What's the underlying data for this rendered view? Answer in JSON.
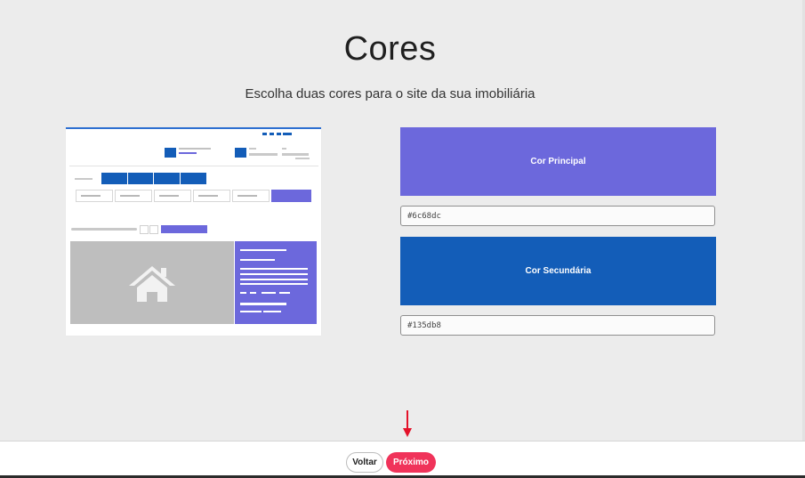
{
  "page": {
    "title": "Cores",
    "subtitle": "Escolha duas cores para o site da sua imobiliária"
  },
  "colors": {
    "primary": {
      "label": "Cor Principal",
      "value": "#6c68dc",
      "swatch": "#6c68dc"
    },
    "secondary": {
      "label": "Cor Secundária",
      "value": "#135db8",
      "swatch": "#135db8"
    }
  },
  "preview": {
    "image_icon": "house-icon",
    "accent": "#6c68dc",
    "secondary": "#135db8"
  },
  "footer": {
    "back_label": "Voltar",
    "next_label": "Próximo",
    "next_color": "#f0335a"
  },
  "annotation": {
    "arrow_icon": "red-arrow-down-icon",
    "color": "#e4122a"
  }
}
